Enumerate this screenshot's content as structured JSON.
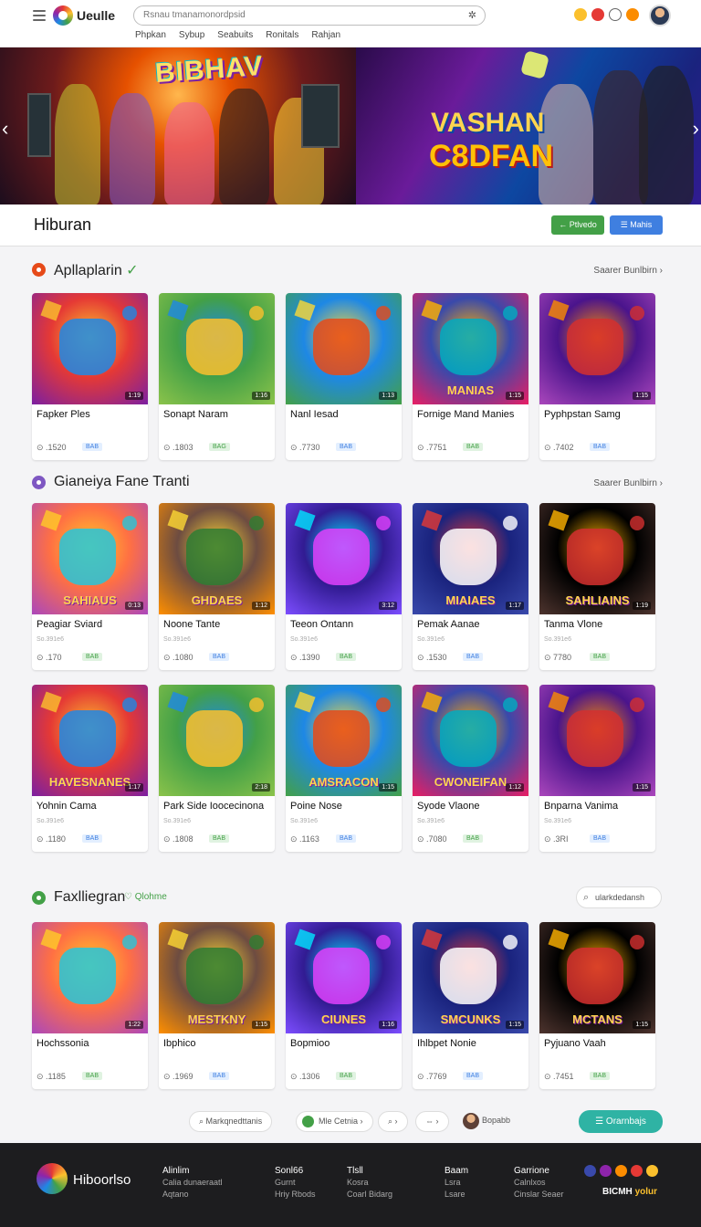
{
  "header": {
    "brand": "Ueulle",
    "search_placeholder": "Rsnau tmanamonordpsid",
    "nav": [
      "Phpkan",
      "Sybup",
      "Seabuits",
      "Ronitals",
      "Rahjan"
    ]
  },
  "hero": {
    "left_title": "BIBHAV",
    "right_title_1": "VASHAN",
    "right_title_2": "C8DFAN"
  },
  "page": {
    "title": "Hiburan",
    "btn_green": "← Ptlvedo",
    "btn_blue": "☰ Mahis"
  },
  "sections": [
    {
      "title": "Apllaplarin",
      "check": "✓",
      "see_all": "Saarer Bunlbirn ›",
      "cards": [
        {
          "name": "Fapker Ples",
          "sub": "",
          "views": "⊙ .1520",
          "tag": "BAB",
          "dur": "1:19",
          "art": ""
        },
        {
          "name": "Sonapt Naram",
          "sub": "",
          "views": "⊙ .1803",
          "tag": "BAG",
          "dur": "1:16",
          "art": ""
        },
        {
          "name": "Nanl Iesad",
          "sub": "",
          "views": "⊙ .7730",
          "tag": "BAB",
          "dur": "1:13",
          "art": ""
        },
        {
          "name": "Fornige Mand Manies",
          "sub": "",
          "views": "⊙ .7751",
          "tag": "BAB",
          "dur": "1:15",
          "art": "MANIAS"
        },
        {
          "name": "Pyphpstan Samg",
          "sub": "",
          "views": "⊙ .7402",
          "tag": "BAB",
          "dur": "1:15",
          "art": ""
        }
      ]
    },
    {
      "title": "Gianeiya Fane Tranti",
      "see_all": "Saarer Bunlbirn ›",
      "cards": [
        {
          "name": "Peagiar Sviard",
          "sub": "So.391e6",
          "views": "⊙ .170",
          "tag": "BAB",
          "dur": "0:13",
          "art": "SAHIAUS"
        },
        {
          "name": "Noone Tante",
          "sub": "So.391e6",
          "views": "⊙ .1080",
          "tag": "BAB",
          "dur": "1:12",
          "art": "GHDAES"
        },
        {
          "name": "Teeon Ontann",
          "sub": "So.391e6",
          "views": "⊙ .1390",
          "tag": "BAB",
          "dur": "3:12",
          "art": ""
        },
        {
          "name": "Pemak Aanae",
          "sub": "So.391e6",
          "views": "⊙ .1530",
          "tag": "BAB",
          "dur": "1:17",
          "art": "MIAIAES"
        },
        {
          "name": "Tanma Vlone",
          "sub": "So.391e6",
          "views": "⊙ 7780",
          "tag": "BAB",
          "dur": "1:19",
          "art": "SAHLIAINS"
        }
      ]
    },
    {
      "title": "",
      "cards": [
        {
          "name": "Yohnin Cama",
          "sub": "So.391e6",
          "views": "⊙ .1180",
          "tag": "BAB",
          "dur": "1:17",
          "art": "HAVESNANES"
        },
        {
          "name": "Park Side Ioocecinona",
          "sub": "So.391e6",
          "views": "⊙ .1808",
          "tag": "BAB",
          "dur": "2:18",
          "art": ""
        },
        {
          "name": "Poine Nose",
          "sub": "So.391e6",
          "views": "⊙ .1163",
          "tag": "BAB",
          "dur": "1:15",
          "art": "AMSRACON"
        },
        {
          "name": "Syode Vlaone",
          "sub": "So.391e6",
          "views": "⊙ .7080",
          "tag": "BAB",
          "dur": "1:12",
          "art": "CWONEIFAN"
        },
        {
          "name": "Bnparna Vanima",
          "sub": "So.391e6",
          "views": "⊙ .3RI",
          "tag": "BAB",
          "dur": "1:15",
          "art": ""
        }
      ]
    },
    {
      "title": "Faxlliegran",
      "extra": "Qlohme",
      "search_placeholder": "ularkdedansh",
      "cards": [
        {
          "name": "Hochssonia",
          "sub": "",
          "views": "⊙ .1185",
          "tag": "BAB",
          "dur": "1:22",
          "art": ""
        },
        {
          "name": "Ibphico",
          "sub": "",
          "views": "⊙ .1969",
          "tag": "BAB",
          "dur": "1:15",
          "art": "MESTKNY"
        },
        {
          "name": "Bopmioo",
          "sub": "",
          "views": "⊙ .1306",
          "tag": "BAB",
          "dur": "1:16",
          "art": "CIUNES"
        },
        {
          "name": "Ihlbpet Nonie",
          "sub": "",
          "views": "⊙ .7769",
          "tag": "BAB",
          "dur": "1:15",
          "art": "SMCUNKS"
        },
        {
          "name": "Pyjuano Vaah",
          "sub": "",
          "views": "⊙ .7451",
          "tag": "BAB",
          "dur": "1:15",
          "art": "MCTANS"
        }
      ]
    }
  ],
  "toolbar": {
    "search": "⌕ Markqnedttanis",
    "filter": "Mle Cetnia ›",
    "zoom": "⌕ ›",
    "share": "⇔ ›",
    "user": "Bopabb",
    "cta": "☰ Orarnbajs"
  },
  "footer": {
    "brand": "Hiboorlso",
    "columns": [
      {
        "h": "Alinlim",
        "l": [
          "Calia dunaeraatl",
          "Aqtano"
        ]
      },
      {
        "h": "Sonl66",
        "l": [
          "Gurnt",
          "Hriy Rbods"
        ]
      },
      {
        "h": "Tlsll",
        "l": [
          "Kosra",
          "Coarl Bidarg"
        ]
      },
      {
        "h": "Baam",
        "l": [
          "Lsra",
          "Lsare"
        ]
      },
      {
        "h": "Garrione",
        "l": [
          "Calnlxos",
          "Cinslar Seaer"
        ]
      }
    ],
    "tag_a": "BICMH",
    "tag_b": "yolur"
  },
  "colors": {
    "accent_green": "#43a047",
    "accent_blue": "#3f7fe0",
    "cta_teal": "#2fb3a4",
    "footer_bg": "#1d1d1f"
  }
}
